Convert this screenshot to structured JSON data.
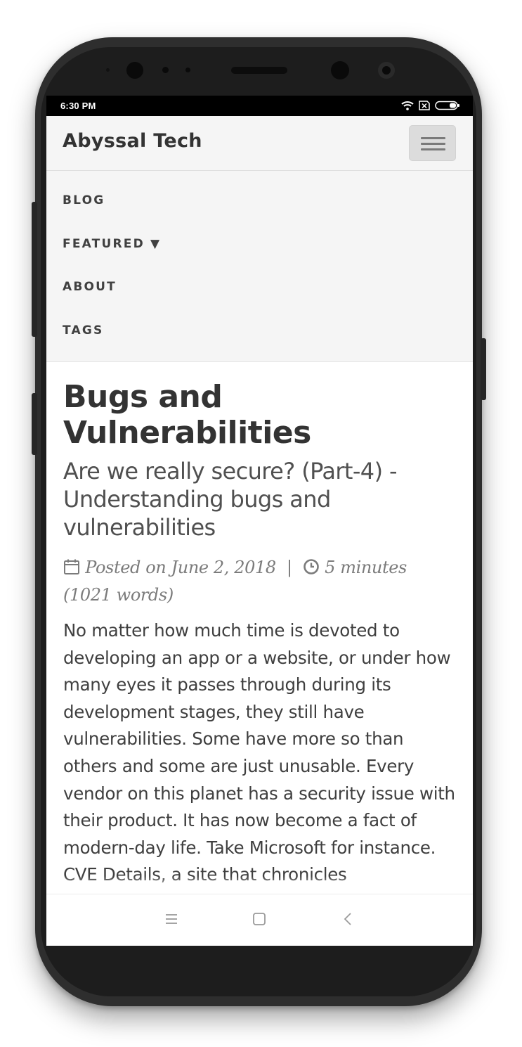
{
  "status_bar": {
    "time": "6:30 PM",
    "icons": [
      "wifi-icon",
      "sim-x-icon",
      "battery-icon"
    ]
  },
  "navbar": {
    "brand": "Abyssal Tech",
    "menu_toggle_icon": "hamburger-icon"
  },
  "menu": {
    "items": [
      {
        "label": "BLOG"
      },
      {
        "label": "FEATURED ▼"
      },
      {
        "label": "ABOUT"
      },
      {
        "label": "TAGS"
      }
    ]
  },
  "post": {
    "title": "Bugs and Vulnerabilities",
    "subtitle": "Are we really secure? (Part-4) - Understanding bugs and vulnerabilities",
    "posted_on": "Posted on June 2, 2018",
    "separator": "|",
    "reading_time": "5 minutes (1021 words)",
    "body": "No matter how much time is devoted to developing an app or a website, or under how many eyes it passes through during its development stages, they still have vulnerabilities. Some have more so than others and some are just unusable. Every vendor on this planet has a security issue with their product. It has now become a fact of modern-day life. Take Microsoft for instance. CVE Details, a site that chronicles"
  },
  "bottom_nav": {
    "icons": [
      "menu-icon",
      "home-icon",
      "back-icon"
    ]
  },
  "colors": {
    "navbar_bg": "#f5f5f5",
    "text_dark": "#333333",
    "meta_gray": "#7b7b7b"
  }
}
